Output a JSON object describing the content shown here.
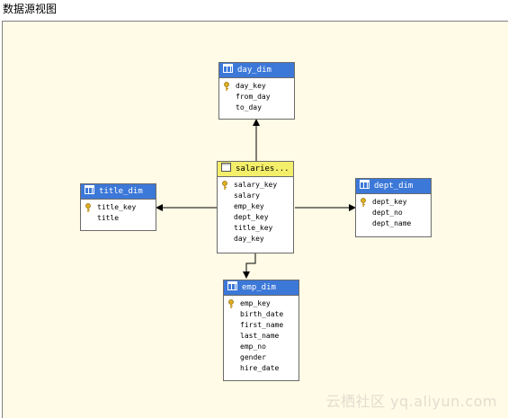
{
  "window": {
    "title": "数据源视图"
  },
  "tables": {
    "day_dim": {
      "name": "day_dim",
      "columns": [
        "day_key",
        "from_day",
        "to_day"
      ]
    },
    "salaries": {
      "name": "salaries...",
      "columns": [
        "salary_key",
        "salary",
        "emp_key",
        "dept_key",
        "title_key",
        "day_key"
      ]
    },
    "title_dim": {
      "name": "title_dim",
      "columns": [
        "title_key",
        "title"
      ]
    },
    "dept_dim": {
      "name": "dept_dim",
      "columns": [
        "dept_key",
        "dept_no",
        "dept_name"
      ]
    },
    "emp_dim": {
      "name": "emp_dim",
      "columns": [
        "emp_key",
        "birth_date",
        "first_name",
        "last_name",
        "emp_no",
        "gender",
        "hire_date"
      ]
    }
  },
  "watermark": "云栖社区 yq.aliyun.com",
  "colors": {
    "dim_header": "#3c78d8",
    "fact_header": "#f4ef6a",
    "canvas": "#fffbe6"
  }
}
